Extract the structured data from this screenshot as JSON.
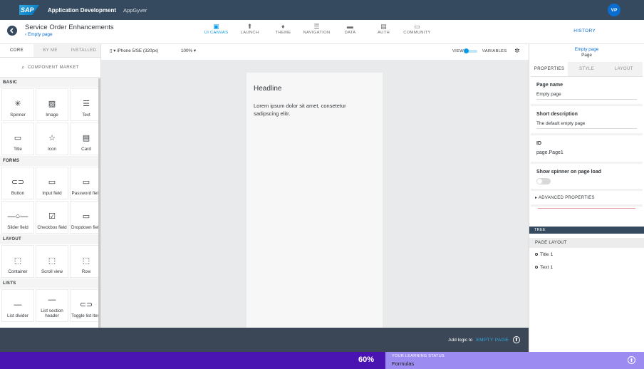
{
  "topbar": {
    "logo": "SAP",
    "title": "Application Development",
    "subtitle": "AppGyver",
    "avatar": "VP"
  },
  "header": {
    "project_title": "Service Order Enhancements",
    "breadcrumb": "‹ Empty page",
    "nav": [
      {
        "label": "UI CANVAS",
        "icon": "▣"
      },
      {
        "label": "LAUNCH",
        "icon": "⬆"
      },
      {
        "label": "THEME",
        "icon": "♦"
      },
      {
        "label": "NAVIGATION",
        "icon": "☰"
      },
      {
        "label": "DATA",
        "icon": "▬"
      },
      {
        "label": "AUTH",
        "icon": "▤"
      },
      {
        "label": "COMMUNITY",
        "icon": "▭"
      }
    ],
    "history": "HISTORY"
  },
  "left": {
    "tabs": [
      "CORE",
      "BY ME",
      "INSTALLED"
    ],
    "market": "COMPONENT MARKET",
    "sections": [
      {
        "title": "BASIC",
        "items": [
          {
            "label": "Spinner",
            "icon": "✳"
          },
          {
            "label": "Image",
            "icon": "▨"
          },
          {
            "label": "Text",
            "icon": "☰"
          },
          {
            "label": "Title",
            "icon": "▭"
          },
          {
            "label": "Icon",
            "icon": "☆"
          },
          {
            "label": "Card",
            "icon": "▤"
          }
        ]
      },
      {
        "title": "FORMS",
        "items": [
          {
            "label": "Button",
            "icon": "⊂⊃"
          },
          {
            "label": "Input field",
            "icon": "▭"
          },
          {
            "label": "Password field",
            "icon": "▭"
          },
          {
            "label": "Slider field",
            "icon": "—○—"
          },
          {
            "label": "Checkbox field",
            "icon": "☑"
          },
          {
            "label": "Dropdown field",
            "icon": "▭"
          }
        ]
      },
      {
        "title": "LAYOUT",
        "items": [
          {
            "label": "Container",
            "icon": "⬚"
          },
          {
            "label": "Scroll view",
            "icon": "⬚"
          },
          {
            "label": "Row",
            "icon": "⬚"
          }
        ]
      },
      {
        "title": "LISTS",
        "items": [
          {
            "label": "List divider",
            "icon": "—"
          },
          {
            "label": "List section header",
            "icon": "—"
          },
          {
            "label": "Toggle list item",
            "icon": "⊂⊃"
          }
        ]
      }
    ]
  },
  "canvas_toolbar": {
    "device": "iPhone 5/SE (320px)",
    "zoom": "100%",
    "view": "VIEW",
    "variables": "VARIABLES"
  },
  "canvas": {
    "headline": "Headline",
    "paragraph": "Lorem ipsum dolor sit amet, consetetur sadipscing elitr."
  },
  "right": {
    "head_link": "Empty page",
    "head_label": "Page",
    "tabs": [
      "PROPERTIES",
      "STYLE",
      "LAYOUT"
    ],
    "page_name_label": "Page name",
    "page_name_value": "Empty page",
    "short_desc_label": "Short description",
    "short_desc_value": "The default empty page",
    "id_label": "ID",
    "id_value": "page.Page1",
    "spinner_label": "Show spinner on page load",
    "advanced": "▸ ADVANCED PROPERTIES",
    "tree": "TREE",
    "page_layout": "PAGE LAYOUT",
    "nodes": [
      "Title 1",
      "Text 1"
    ]
  },
  "logic": {
    "prefix": "Add logic to",
    "page": "EMPTY PAGE",
    "icon": "⬆"
  },
  "learning": {
    "percent": "60%",
    "label": "YOUR LEARNING STATUS",
    "value": "Formulas",
    "icon": "⬆"
  }
}
